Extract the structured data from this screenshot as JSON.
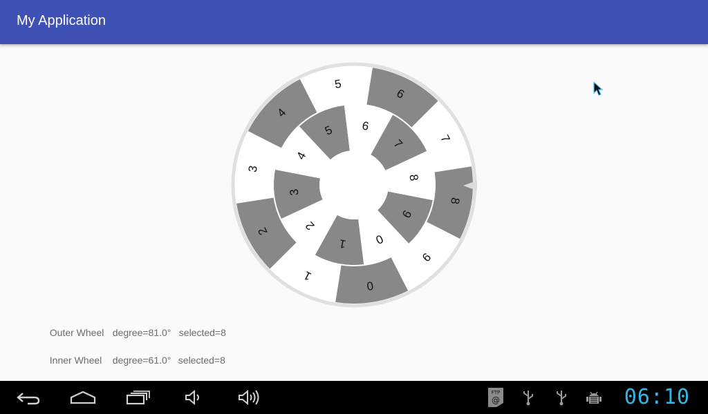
{
  "app": {
    "title": "My Application"
  },
  "wheel": {
    "outer": {
      "labels": [
        "8",
        "9",
        "0",
        "1",
        "2",
        "3",
        "4",
        "5",
        "6",
        "7"
      ],
      "shaded": [
        true,
        false,
        true,
        false,
        true,
        false,
        true,
        false,
        true,
        false
      ]
    },
    "inner": {
      "labels": [
        "9",
        "0",
        "1",
        "2",
        "3",
        "4",
        "5",
        "6",
        "7",
        "8"
      ],
      "shaded": [
        true,
        false,
        true,
        false,
        true,
        false,
        true,
        false,
        true,
        false
      ]
    },
    "colors": {
      "shaded": "#888888",
      "light": "#ffffff",
      "rim": "#e0e0dc",
      "hub": "#ffffff"
    }
  },
  "info": {
    "outer": {
      "label": "Outer Wheel",
      "degree": "degree=81.0°",
      "selected": "selected=8"
    },
    "inner": {
      "label": "Inner Wheel",
      "degree": "degree=61.0°",
      "selected": "selected=8"
    }
  },
  "statusbar": {
    "clock": "06:10",
    "ftp_text": "FTP"
  },
  "icons": {
    "nav": [
      "back-icon",
      "home-icon",
      "recents-icon",
      "volume-down-icon",
      "volume-up-icon"
    ],
    "status": [
      "ftp-server-icon",
      "usb-icon",
      "usb-debug-icon",
      "android-debug-icon"
    ]
  }
}
